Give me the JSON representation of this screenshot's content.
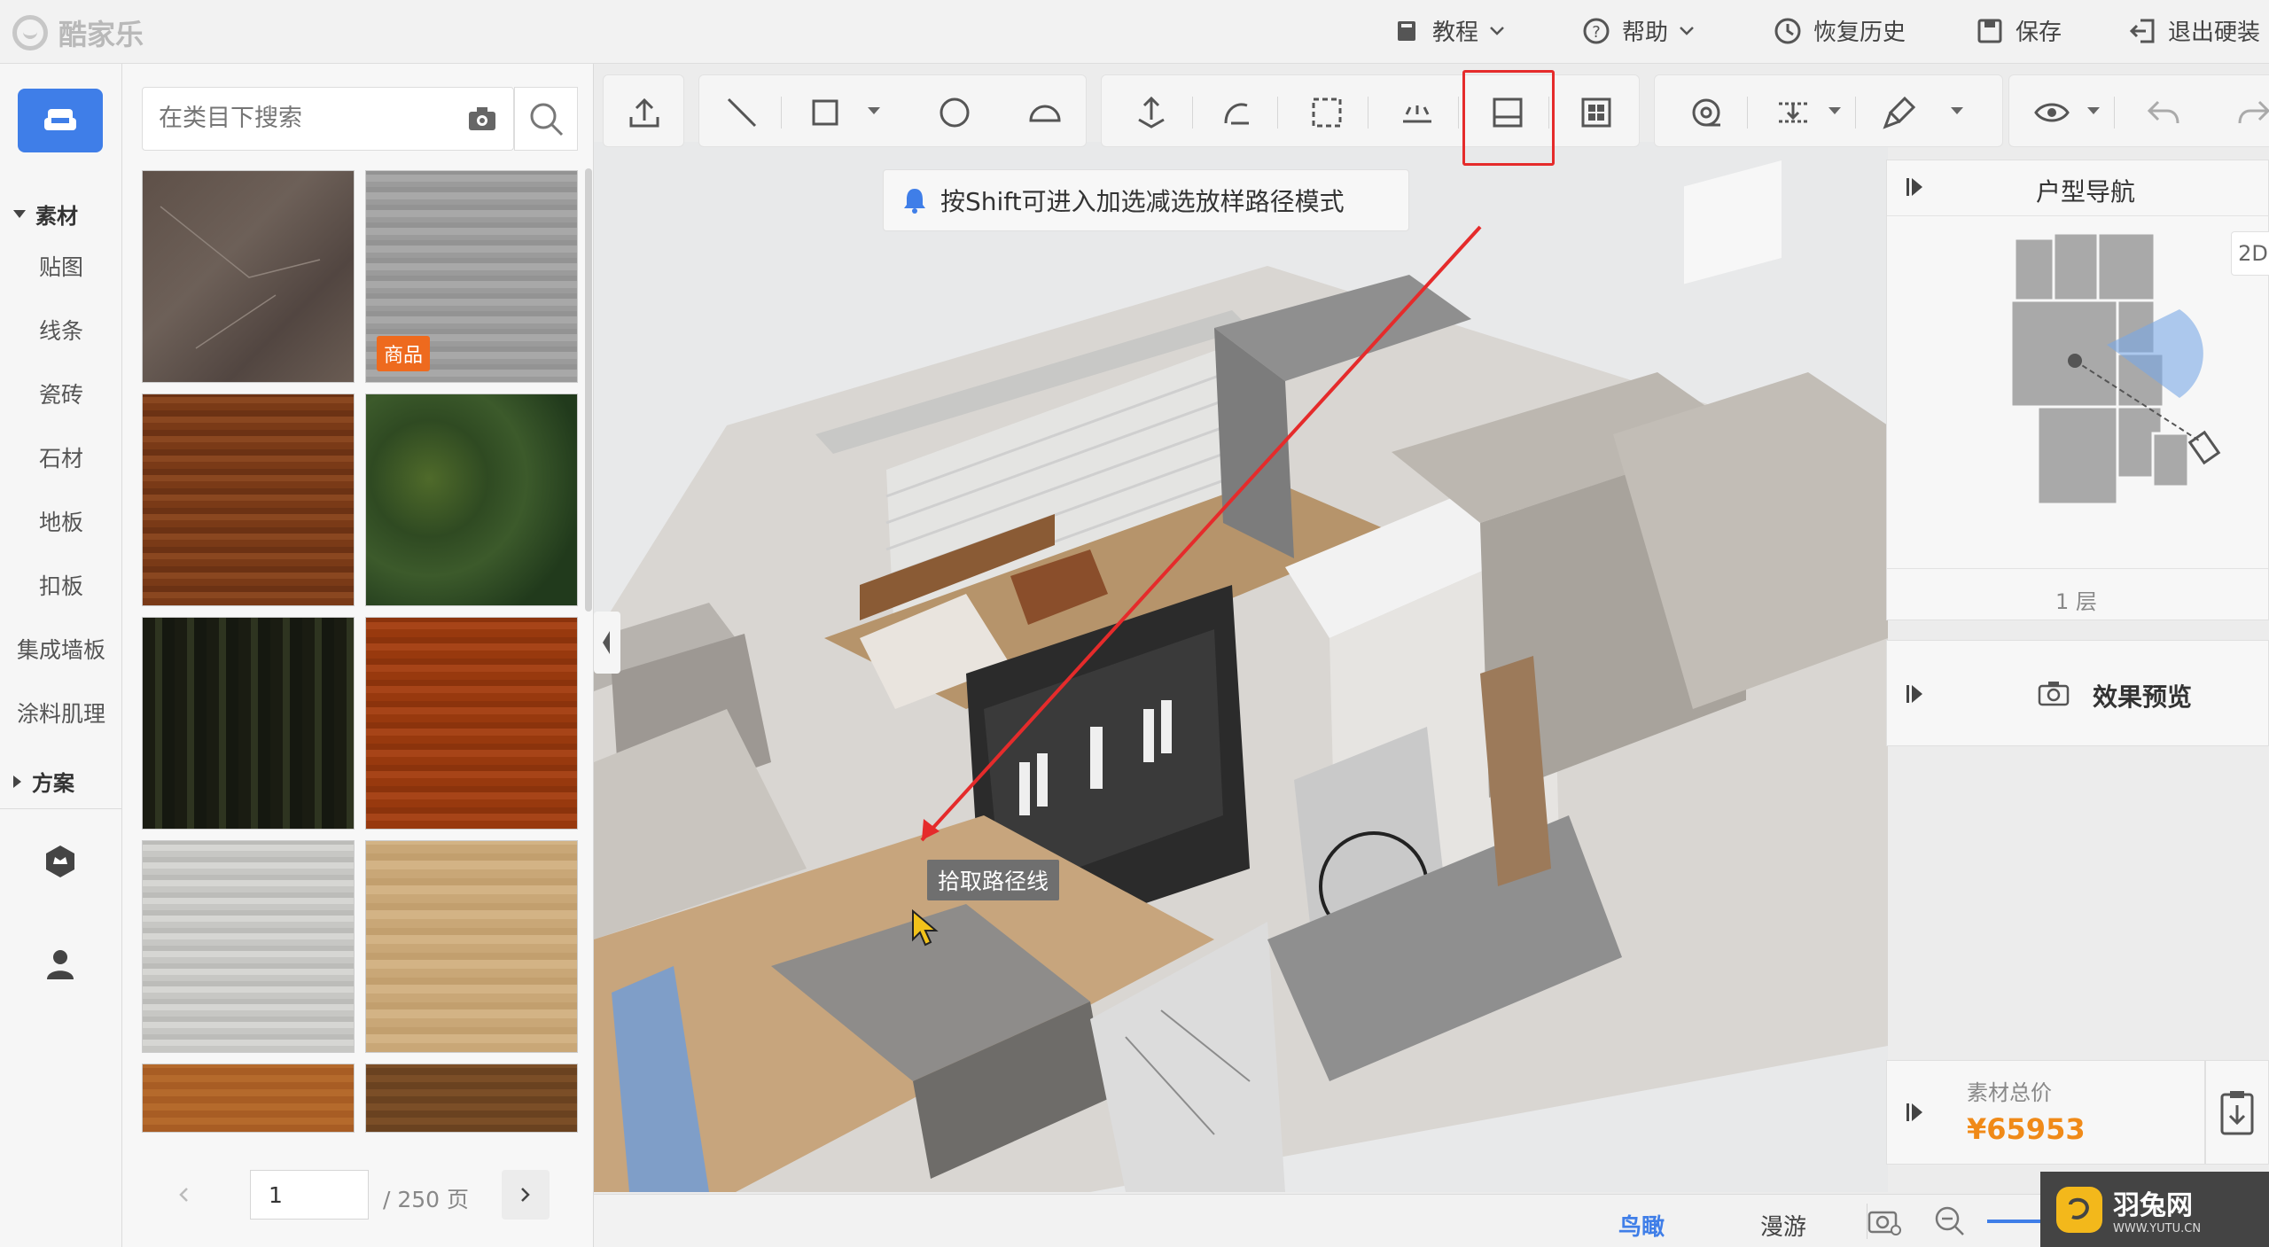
{
  "app": {
    "name": "酷家乐"
  },
  "topmenu": {
    "tutorial": "教程",
    "help": "帮助",
    "restore_history": "恢复历史",
    "save": "保存",
    "exit": "退出硬装"
  },
  "rail": {
    "section_material": "素材",
    "items": [
      "贴图",
      "线条",
      "瓷砖",
      "石材",
      "地板",
      "扣板",
      "集成墙板",
      "涂料肌理"
    ],
    "section_plan": "方案"
  },
  "panel": {
    "search_placeholder": "在类目下搜索",
    "badge": "商品",
    "page_current": "1",
    "page_total": "/ 250 页"
  },
  "tip": {
    "text": "按Shift可进入加选减选放样路径模式"
  },
  "canvas": {
    "cursor_tooltip": "拾取路径线"
  },
  "nav": {
    "title": "户型导航",
    "mode_button": "2D",
    "floor_label": "1 层"
  },
  "preview": {
    "title": "效果预览"
  },
  "price": {
    "label": "素材总价",
    "value": "¥65953"
  },
  "bottom": {
    "tab_birdview": "鸟瞰",
    "tab_roam": "漫游"
  },
  "watermark": {
    "text": "羽兔网",
    "sub": "WWW.YUTU.CN"
  },
  "colors": {
    "accent": "#3f7ee8",
    "price": "#f08a18",
    "highlight": "#e52b2b",
    "badge": "#ee6a1e"
  }
}
